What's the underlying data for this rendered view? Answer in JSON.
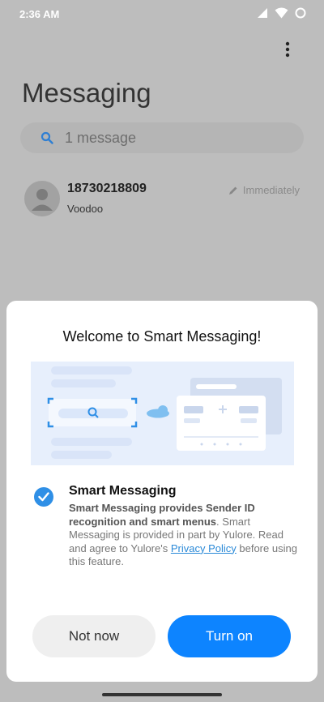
{
  "status_bar": {
    "time": "2:36 AM"
  },
  "header": {
    "title": "Messaging"
  },
  "search": {
    "text": "1 message"
  },
  "conversation": {
    "name": "18730218809",
    "snippet": "Voodoo",
    "time": "Immediately"
  },
  "dialog": {
    "title": "Welcome to Smart Messaging!",
    "feature_title": "Smart Messaging",
    "desc_bold": "Smart Messaging provides Sender ID recognition and smart menus",
    "desc_part1": ". Smart Messaging is provided in part by Yulore. Read and agree to Yulore's ",
    "link": "Privacy Policy",
    "desc_part2": " before using this feature.",
    "checked": true,
    "secondary_button": "Not now",
    "primary_button": "Turn on"
  },
  "colors": {
    "accent": "#0d84ff",
    "check": "#2f8fe6",
    "link": "#2b8ad8"
  }
}
